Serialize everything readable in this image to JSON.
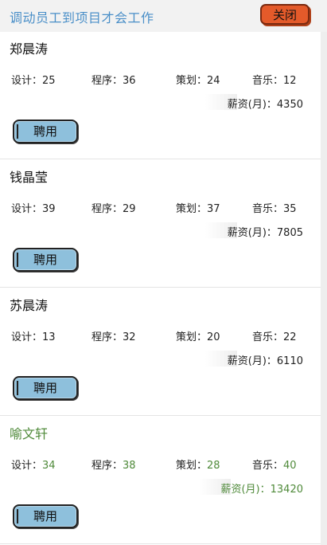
{
  "header": {
    "title": "调动员工到项目才会工作",
    "close_label": "关闭"
  },
  "labels": {
    "design": "设计：",
    "program": "程序：",
    "plan": "策划：",
    "music": "音乐：",
    "salary": "薪资(月)：",
    "hire": "聘用"
  },
  "employees": [
    {
      "name": "郑晨涛",
      "design": "25",
      "program": "36",
      "plan": "24",
      "music": "12",
      "salary": "4350",
      "highlight": false
    },
    {
      "name": "钱晶莹",
      "design": "39",
      "program": "29",
      "plan": "37",
      "music": "35",
      "salary": "7805",
      "highlight": false
    },
    {
      "name": "苏晨涛",
      "design": "13",
      "program": "32",
      "plan": "20",
      "music": "22",
      "salary": "6110",
      "highlight": false
    },
    {
      "name": "喻文轩",
      "design": "34",
      "program": "38",
      "plan": "28",
      "music": "40",
      "salary": "13420",
      "highlight": true
    }
  ],
  "colors": {
    "title": "#4a8fc8",
    "close_button": "#e45a2a",
    "hire_button": "#8ec0dc",
    "highlight_text": "#4f8a3a"
  }
}
